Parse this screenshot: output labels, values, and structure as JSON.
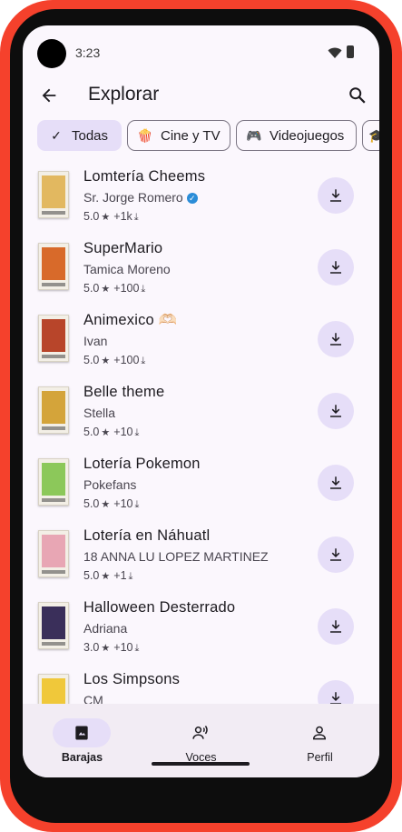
{
  "status": {
    "time": "3:23"
  },
  "appbar": {
    "title": "Explorar"
  },
  "chips": [
    {
      "label": "Todas",
      "icon": "check-icon",
      "selected": true
    },
    {
      "label": "Cine y TV",
      "icon": "popcorn-icon",
      "selected": false
    },
    {
      "label": "Videojuegos",
      "icon": "gamepad-icon",
      "selected": false
    },
    {
      "label": "",
      "icon": "graduation-cap-icon",
      "selected": false
    }
  ],
  "decks": [
    {
      "name": "Lomtería Cheems",
      "author": "Sr. Jorge Romero",
      "verified": true,
      "rating": "5.0",
      "downloads": "+1k",
      "color": "#e2b860"
    },
    {
      "name": "SuperMario",
      "author": "Tamica Moreno",
      "verified": false,
      "rating": "5.0",
      "downloads": "+100",
      "color": "#d86a2a"
    },
    {
      "name": "Animexico 🫶🏻",
      "author": "Ivan",
      "verified": false,
      "rating": "5.0",
      "downloads": "+100",
      "color": "#b8452a"
    },
    {
      "name": "Belle theme",
      "author": "Stella",
      "verified": false,
      "rating": "5.0",
      "downloads": "+10",
      "color": "#d4a43a"
    },
    {
      "name": "Lotería Pokemon",
      "author": "Pokefans",
      "verified": false,
      "rating": "5.0",
      "downloads": "+10",
      "color": "#8cc85a"
    },
    {
      "name": "Lotería en Náhuatl",
      "author": "18 ANNA LU LOPEZ MARTINEZ",
      "verified": false,
      "rating": "5.0",
      "downloads": "+1",
      "color": "#e8a6b4"
    },
    {
      "name": "Halloween Desterrado",
      "author": "Adriana",
      "verified": false,
      "rating": "3.0",
      "downloads": "+10",
      "color": "#3a2f5a"
    },
    {
      "name": "Los Simpsons",
      "author": "CM",
      "verified": false,
      "rating": "",
      "downloads": "",
      "color": "#f0c83a"
    }
  ],
  "nav": {
    "items": [
      {
        "label": "Barajas",
        "icon": "cards-icon",
        "active": true
      },
      {
        "label": "Voces",
        "icon": "voice-icon",
        "active": false
      },
      {
        "label": "Perfil",
        "icon": "person-icon",
        "active": false
      }
    ]
  },
  "colors": {
    "accent": "#e6def8",
    "frame": "#f5412c",
    "background": "#fbf7fd"
  }
}
